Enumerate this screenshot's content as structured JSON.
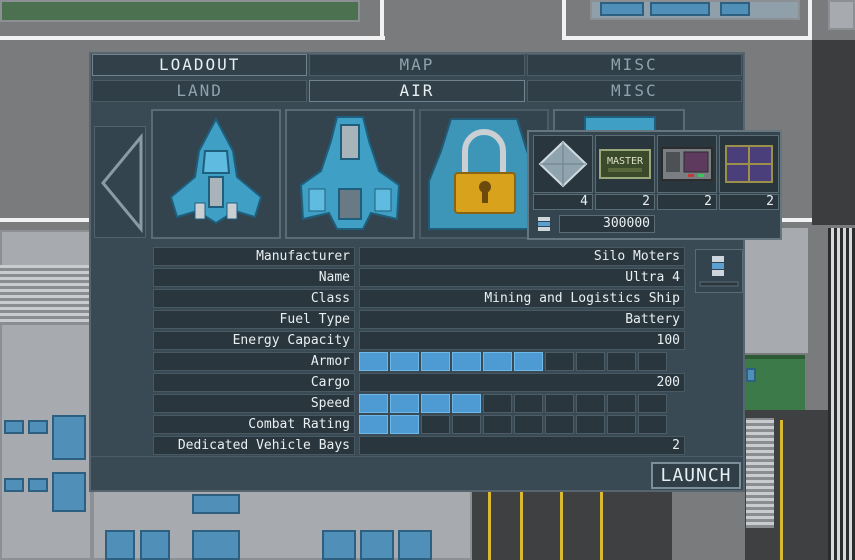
{
  "tabs": {
    "categories": [
      "LOADOUT",
      "MAP",
      "MISC"
    ],
    "subcategories": [
      "LAND",
      "AIR",
      "MISC"
    ],
    "active_category": "LOADOUT",
    "active_subcategory": "AIR"
  },
  "inventory": {
    "items": [
      {
        "icon": "crystal-icon",
        "count": "4"
      },
      {
        "icon": "master-chip-icon",
        "label": "MASTER",
        "count": "2"
      },
      {
        "icon": "console-module-icon",
        "count": "2"
      },
      {
        "icon": "purple-panel-icon",
        "count": "2"
      }
    ],
    "credits": "300000"
  },
  "ship": {
    "stats": [
      {
        "label": "Manufacturer",
        "value": "Silo Moters"
      },
      {
        "label": "Name",
        "value": "Ultra 4"
      },
      {
        "label": "Class",
        "value": "Mining and Logistics Ship"
      },
      {
        "label": "Fuel Type",
        "value": "Battery"
      },
      {
        "label": "Energy Capacity",
        "value": "100"
      },
      {
        "label": "Armor",
        "bar": 6,
        "max": 10
      },
      {
        "label": "Cargo",
        "value": "200"
      },
      {
        "label": "Speed",
        "bar": 4,
        "max": 10
      },
      {
        "label": "Combat Rating",
        "bar": 2,
        "max": 10
      },
      {
        "label": "Dedicated Vehicle Bays",
        "value": "2"
      }
    ]
  },
  "ship_slots": [
    {
      "icon": "fighter-ship-icon",
      "locked": false
    },
    {
      "icon": "hauler-ship-icon",
      "locked": false
    },
    {
      "icon": "locked-ship-icon",
      "locked": true
    },
    {
      "icon": "ship-icon",
      "locked": false
    }
  ],
  "launch_label": "LAUNCH",
  "colors": {
    "accent": "#4d9bd2",
    "panel": "#394a55",
    "lock": "#d9a21d"
  }
}
